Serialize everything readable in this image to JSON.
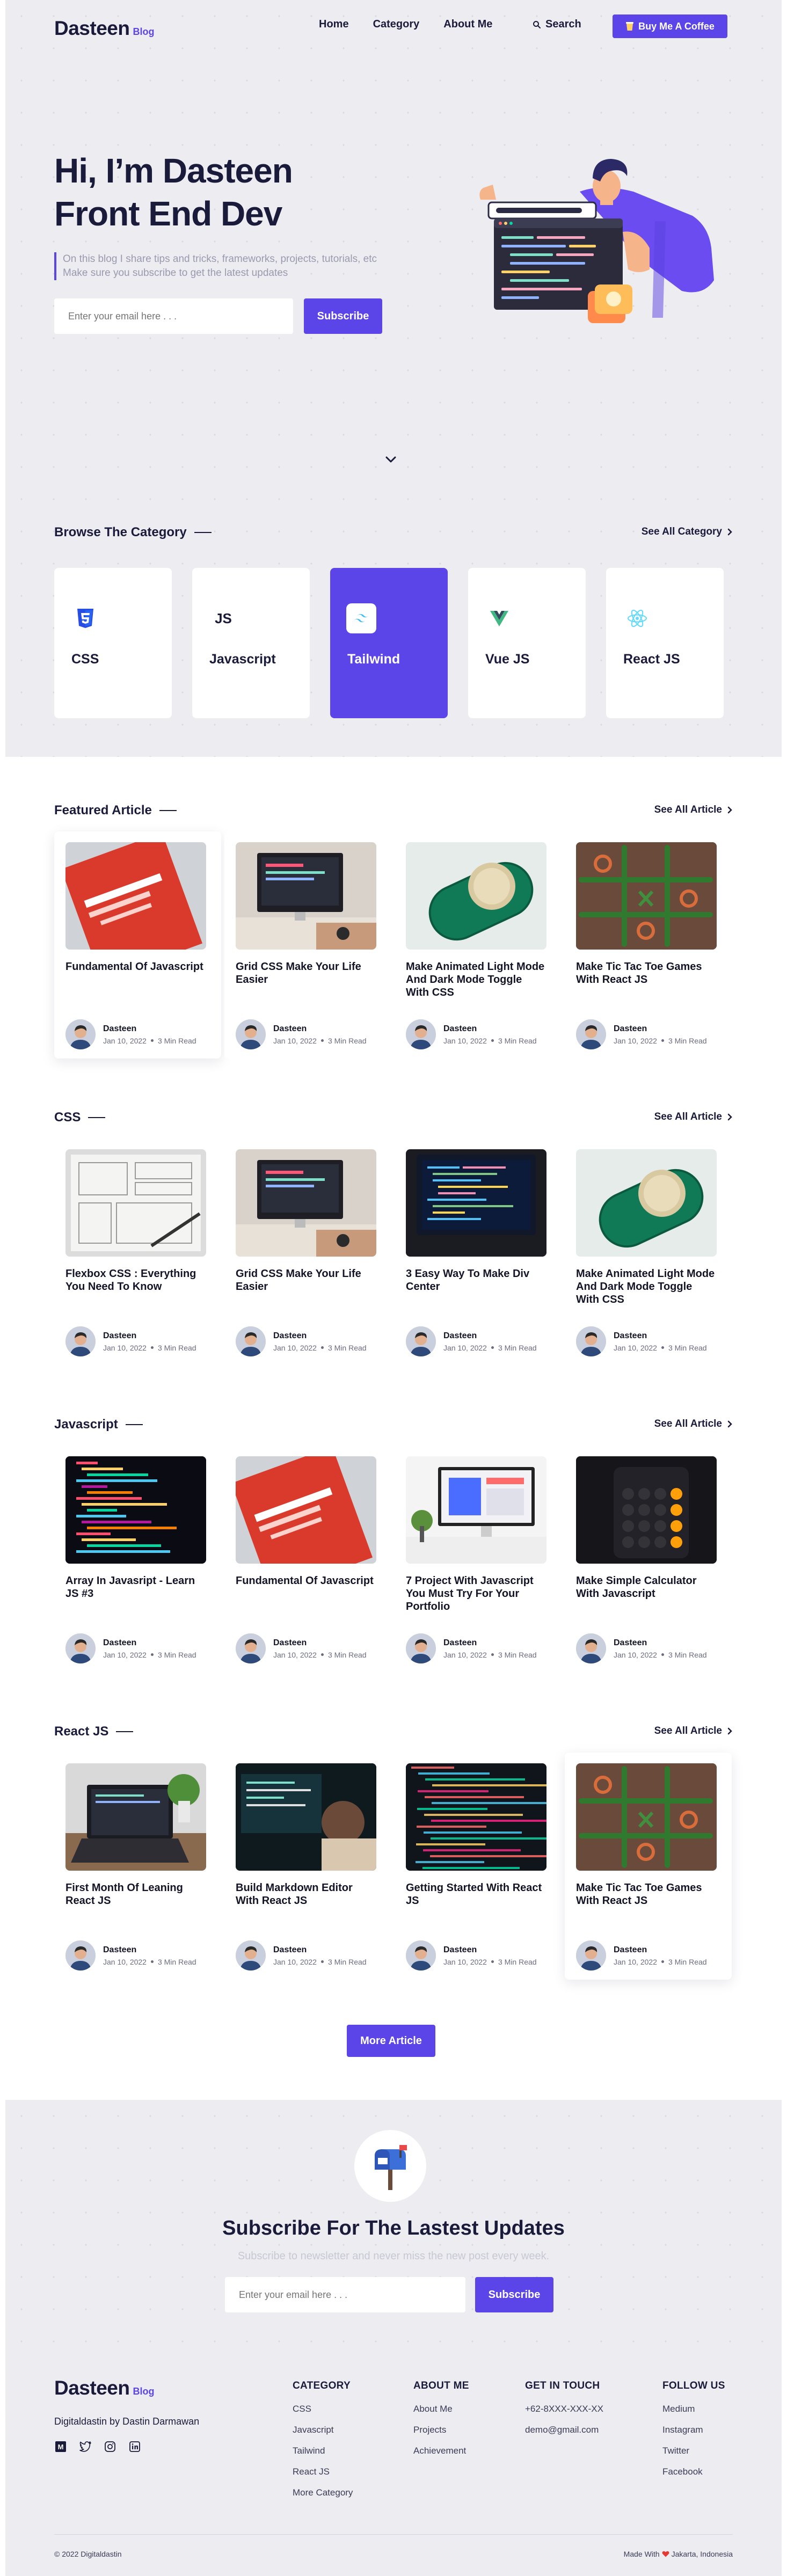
{
  "nav": {
    "logo": "Dasteen",
    "logo_sub": "Blog",
    "menu": [
      "Home",
      "Category",
      "About Me"
    ],
    "search_label": "Search",
    "coffee_label": "Buy Me A Coffee"
  },
  "hero": {
    "title_line1": "Hi, I’m Dasteen",
    "title_line2": "Front End Dev",
    "desc_line1": "On this blog I share tips and tricks, frameworks, projects, tutorials, etc",
    "desc_line2": "Make sure you subscribe to get the latest updates",
    "email_placeholder": "Enter your email here . . .",
    "subscribe_label": "Subscribe"
  },
  "categories": {
    "title": "Browse The Category",
    "see_all": "See All Category",
    "items": [
      {
        "label": "CSS",
        "icon": "css3-icon"
      },
      {
        "label": "Javascript",
        "icon": "js-icon"
      },
      {
        "label": "Tailwind",
        "icon": "tailwind-icon",
        "active": true
      },
      {
        "label": "Vue JS",
        "icon": "vue-icon"
      },
      {
        "label": "React JS",
        "icon": "react-icon"
      }
    ]
  },
  "author": {
    "name": "Dasteen",
    "date": "Jan 10, 2022",
    "read": "3 Min Read"
  },
  "sections": [
    {
      "title": "Featured Article",
      "see_all": "See All Article",
      "articles": [
        {
          "title": "Fundamental Of Javascript",
          "thumb": "red-book"
        },
        {
          "title": "Grid CSS Make Your Life Easier",
          "thumb": "imac-desk"
        },
        {
          "title": "Make Animated Light Mode And Dark Mode Toggle With CSS",
          "thumb": "toggle-switch"
        },
        {
          "title": "Make Tic Tac Toe Games With React JS",
          "thumb": "tictactoe"
        }
      ]
    },
    {
      "title": "CSS",
      "see_all": "See All Article",
      "articles": [
        {
          "title": "Flexbox CSS : Everything You Need To Know",
          "thumb": "wireframe-paper"
        },
        {
          "title": "Grid CSS Make Your Life Easier",
          "thumb": "imac-desk"
        },
        {
          "title": "3 Easy Way To Make Div Center",
          "thumb": "code-laptop"
        },
        {
          "title": "Make Animated Light Mode And Dark Mode Toggle With CSS",
          "thumb": "toggle-switch"
        }
      ]
    },
    {
      "title": "Javascript",
      "see_all": "See All Article",
      "articles": [
        {
          "title": "Array In Javasript - Learn JS #3",
          "thumb": "colored-code"
        },
        {
          "title": "Fundamental Of Javascript",
          "thumb": "red-book"
        },
        {
          "title": "7 Project With Javascript You Must Try For Your Portfolio",
          "thumb": "white-desk"
        },
        {
          "title": "Make Simple Calculator With Javascript",
          "thumb": "calculator"
        }
      ]
    },
    {
      "title": "React JS",
      "see_all": "See All Article",
      "articles": [
        {
          "title": "First Month Of Leaning React JS",
          "thumb": "laptop-plant"
        },
        {
          "title": "Build Markdown Editor With React JS",
          "thumb": "dev-monitors"
        },
        {
          "title": "Getting Started With React JS",
          "thumb": "matrix-code"
        },
        {
          "title": "Make Tic Tac Toe Games With React JS",
          "thumb": "tictactoe"
        }
      ]
    }
  ],
  "more_article": "More Article",
  "subscribe": {
    "title": "Subscribe For The Lastest Updates",
    "desc": "Subscribe to newsletter and never miss the new post every week.",
    "placeholder": "Enter your email here . . .",
    "button": "Subscribe"
  },
  "footer": {
    "logo": "Dasteen",
    "logo_sub": "Blog",
    "tagline": "Digitaldastin by Dastin Darmawan",
    "category_title": "CATEGORY",
    "category_links": [
      "CSS",
      "Javascript",
      "Tailwind",
      "React JS",
      "More Category"
    ],
    "about_title": "ABOUT ME",
    "about_links": [
      "About Me",
      "Projects",
      "Achievement"
    ],
    "touch_title": "GET IN TOUCH",
    "touch_links": [
      "+62-8XXX-XXX-XX",
      "demo@gmail.com"
    ],
    "follow_title": "FOLLOW US",
    "follow_links": [
      "Medium",
      "Instagram",
      "Twitter",
      "Facebook"
    ],
    "copyright": "© 2022 Digitaldastin",
    "made_prefix": "Made With",
    "made_suffix": "Jakarta, Indonesia"
  },
  "colors": {
    "accent": "#5b45e8",
    "background": "#ececf1",
    "text": "#1a1a3a"
  }
}
